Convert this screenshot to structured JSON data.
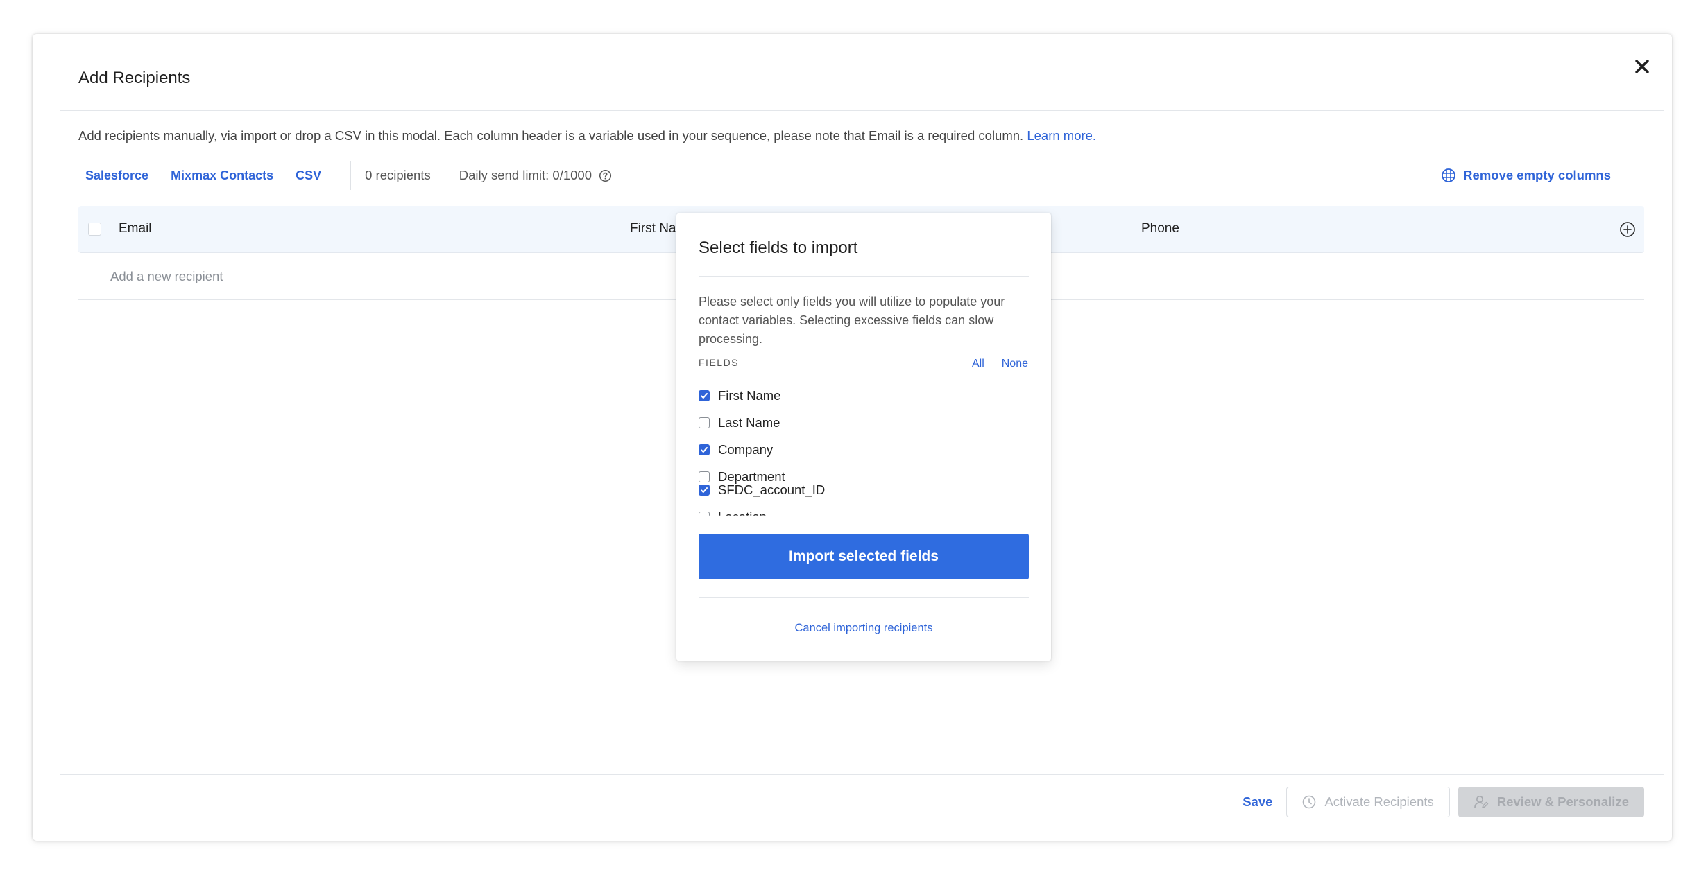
{
  "modal": {
    "title": "Add Recipients",
    "description": "Add recipients manually, via import or drop a CSV in this modal. Each column header is a variable used in your sequence, please note that Email is a required column.",
    "learn_more": "Learn more."
  },
  "toolbar": {
    "sources": [
      "Salesforce",
      "Mixmax Contacts",
      "CSV"
    ],
    "recipient_count": "0 recipients",
    "daily_limit": "Daily send limit: 0/1000",
    "remove_empty": "Remove empty columns"
  },
  "table": {
    "columns": [
      "Email",
      "First Nar",
      "Phone"
    ],
    "add_row_placeholder": "Add a new recipient"
  },
  "footer": {
    "save": "Save",
    "activate": "Activate Recipients",
    "review": "Review & Personalize"
  },
  "popup": {
    "title": "Select fields to import",
    "description": "Please select only fields you will utilize to populate your contact variables. Selecting excessive fields can slow processing.",
    "fields_label": "FIELDS",
    "all": "All",
    "none": "None",
    "fields": [
      {
        "label": "First Name",
        "checked": true
      },
      {
        "label": "Last Name",
        "checked": false
      },
      {
        "label": "Company",
        "checked": true
      },
      {
        "label": "Department",
        "checked": false
      },
      {
        "label": "SFDC_account_ID",
        "checked": true
      },
      {
        "label": "Location",
        "checked": false
      }
    ],
    "import_button": "Import selected fields",
    "cancel": "Cancel importing recipients"
  },
  "colors": {
    "accent": "#2f64d8",
    "primary_button": "#2f6ce0",
    "header_bg": "#f2f7fd"
  }
}
